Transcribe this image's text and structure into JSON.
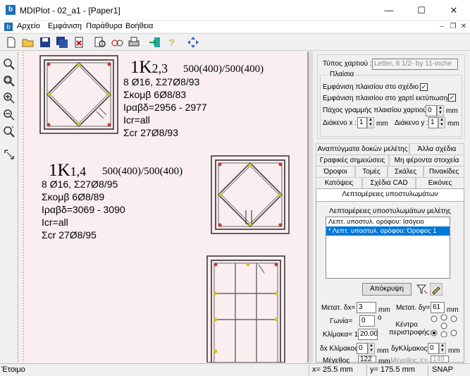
{
  "window": {
    "title": "MDIPlot - 02_a1 - [Paper1]",
    "min": "—",
    "max": "☐",
    "close": "✕"
  },
  "menu": {
    "items": [
      "Αρχείο",
      "Εμφάνιση",
      "Παράθυρα",
      "Βοήθεια"
    ]
  },
  "status": {
    "ready": "Έτοιμο",
    "x": "x=  25.5 mm",
    "y": "y=  175.5 mm",
    "snap": "SNAP"
  },
  "drawing": {
    "col1": {
      "name": "1K",
      "idx": "2,3",
      "dims": "500(400)/500(400)",
      "l1": "8 Ø16, Σ27Ø8/93",
      "l2": "Σκομβ 6Ø8/83",
      "l3": "Ιραβδ=2956 - 2977",
      "l4": "Icr=all",
      "l5": "Σcr 27Ø8/93"
    },
    "col2": {
      "name": "1K",
      "idx": "1,4",
      "dims": "500(400)/500(400)",
      "l1": "8 Ø16, Σ27Ø8/95",
      "l2": "Σκομβ 6Ø8/89",
      "l3": "Ιραβδ=3069 - 3090",
      "l4": "Icr=all",
      "l5": "Σcr 27Ø8/95"
    }
  },
  "panel": {
    "paper_type_label": "Τύπος χαρτιού :",
    "paper_type_value": "Letter, 8 1/2- by 11-inche",
    "frames_legend": "Πλαίσια",
    "show_frame_drawing": "Εμφάνιση πλαισίου στο σχέδιο :",
    "show_frame_print": "Εμφάνιση πλαισίου στο χαρτί εκτύπωσης :",
    "line_thickness_label": "Πάχος γραμμής πλαισίου χαρτιού :",
    "line_thickness_value": "0",
    "line_unit": "mm",
    "spacing_x_label": "Διάκενο x :",
    "spacing_x_value": "1",
    "spacing_y_label": "Διάκενο y :",
    "spacing_y_value": "1",
    "unit_mm": "mm",
    "tabs_row1": [
      "Αναπτύγματα δοκών μελέτης",
      "Άλλα σχέδια"
    ],
    "tabs_row2": [
      "Γραφικές σημειώσεις",
      "Μη φέροντα στοιχεία"
    ],
    "tabs_row3": [
      "Όροφοι",
      "Τομές",
      "Σκάλες",
      "Πινακίδες"
    ],
    "tabs_row4": [
      "Κατόψεις",
      "Σχέδια CAD",
      "Εικόνες"
    ],
    "active_tab": "Λεπτομέρειες υποστυλωμάτων",
    "details_group": "Λεπτομέρειες υποστυλωμάτων μελέτης",
    "list": [
      "Λεπτ. υποστυλ. ορόφου: Ισόγειο",
      "* Λεπτ. υποστυλ. ορόφου: Όροφος 1"
    ],
    "hide_button": "Απόκρυψη",
    "move_dx_label": "Μετατ. δx=",
    "move_dx_value": "3",
    "move_dy_label": "Μετατ. δy=",
    "move_dy_value": "61",
    "angle_label": "Γωνία=",
    "angle_value": "0",
    "angle_unit": "o",
    "rotation_center_label": "Κέντρο περιστροφής:",
    "scale_label": "Κλίμακα= 1:",
    "scale_value": "20.00",
    "dx_scale_label": "δx Κλίμακος=",
    "dx_scale_value": "0",
    "dy_scale_label": "δyΚλίμακος=",
    "dy_scale_value": "0",
    "size_label": "Μέγεθος",
    "size_value": "122",
    "size_y_label": "Μέγεθος Υ=",
    "size_y_value": "149"
  }
}
